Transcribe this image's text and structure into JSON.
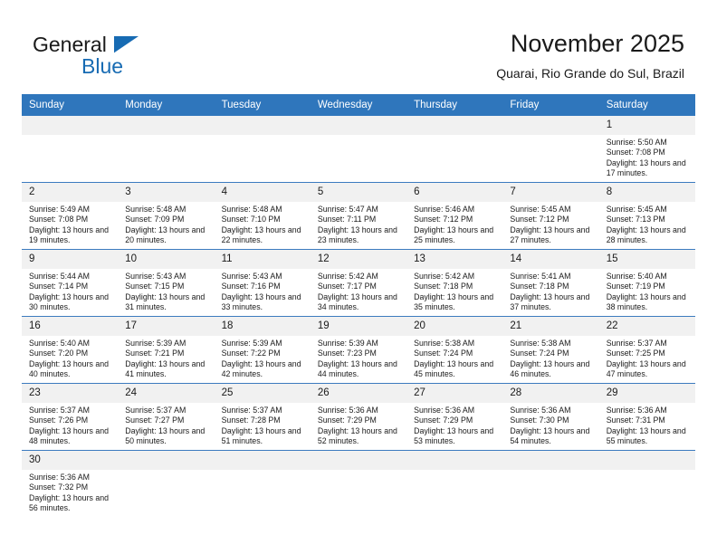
{
  "brand": {
    "name_part1": "General",
    "name_part2": "Blue"
  },
  "header": {
    "title": "November 2025",
    "subtitle": "Quarai, Rio Grande do Sul, Brazil"
  },
  "colors": {
    "header_blue": "#2f76bc",
    "brand_blue": "#176bb3",
    "row_divider": "#3c7bbf",
    "daynum_band": "#f1f1f1"
  },
  "weekdays": [
    "Sunday",
    "Monday",
    "Tuesday",
    "Wednesday",
    "Thursday",
    "Friday",
    "Saturday"
  ],
  "labels": {
    "sunrise_prefix": "Sunrise:",
    "sunset_prefix": "Sunset:",
    "daylight_prefix": "Daylight:"
  },
  "weeks": [
    [
      {
        "day": "",
        "empty": true
      },
      {
        "day": "",
        "empty": true
      },
      {
        "day": "",
        "empty": true
      },
      {
        "day": "",
        "empty": true
      },
      {
        "day": "",
        "empty": true
      },
      {
        "day": "",
        "empty": true
      },
      {
        "day": "1",
        "sunrise": "Sunrise: 5:50 AM",
        "sunset": "Sunset: 7:08 PM",
        "daylight": "Daylight: 13 hours and 17 minutes."
      }
    ],
    [
      {
        "day": "2",
        "sunrise": "Sunrise: 5:49 AM",
        "sunset": "Sunset: 7:08 PM",
        "daylight": "Daylight: 13 hours and 19 minutes."
      },
      {
        "day": "3",
        "sunrise": "Sunrise: 5:48 AM",
        "sunset": "Sunset: 7:09 PM",
        "daylight": "Daylight: 13 hours and 20 minutes."
      },
      {
        "day": "4",
        "sunrise": "Sunrise: 5:48 AM",
        "sunset": "Sunset: 7:10 PM",
        "daylight": "Daylight: 13 hours and 22 minutes."
      },
      {
        "day": "5",
        "sunrise": "Sunrise: 5:47 AM",
        "sunset": "Sunset: 7:11 PM",
        "daylight": "Daylight: 13 hours and 23 minutes."
      },
      {
        "day": "6",
        "sunrise": "Sunrise: 5:46 AM",
        "sunset": "Sunset: 7:12 PM",
        "daylight": "Daylight: 13 hours and 25 minutes."
      },
      {
        "day": "7",
        "sunrise": "Sunrise: 5:45 AM",
        "sunset": "Sunset: 7:12 PM",
        "daylight": "Daylight: 13 hours and 27 minutes."
      },
      {
        "day": "8",
        "sunrise": "Sunrise: 5:45 AM",
        "sunset": "Sunset: 7:13 PM",
        "daylight": "Daylight: 13 hours and 28 minutes."
      }
    ],
    [
      {
        "day": "9",
        "sunrise": "Sunrise: 5:44 AM",
        "sunset": "Sunset: 7:14 PM",
        "daylight": "Daylight: 13 hours and 30 minutes."
      },
      {
        "day": "10",
        "sunrise": "Sunrise: 5:43 AM",
        "sunset": "Sunset: 7:15 PM",
        "daylight": "Daylight: 13 hours and 31 minutes."
      },
      {
        "day": "11",
        "sunrise": "Sunrise: 5:43 AM",
        "sunset": "Sunset: 7:16 PM",
        "daylight": "Daylight: 13 hours and 33 minutes."
      },
      {
        "day": "12",
        "sunrise": "Sunrise: 5:42 AM",
        "sunset": "Sunset: 7:17 PM",
        "daylight": "Daylight: 13 hours and 34 minutes."
      },
      {
        "day": "13",
        "sunrise": "Sunrise: 5:42 AM",
        "sunset": "Sunset: 7:18 PM",
        "daylight": "Daylight: 13 hours and 35 minutes."
      },
      {
        "day": "14",
        "sunrise": "Sunrise: 5:41 AM",
        "sunset": "Sunset: 7:18 PM",
        "daylight": "Daylight: 13 hours and 37 minutes."
      },
      {
        "day": "15",
        "sunrise": "Sunrise: 5:40 AM",
        "sunset": "Sunset: 7:19 PM",
        "daylight": "Daylight: 13 hours and 38 minutes."
      }
    ],
    [
      {
        "day": "16",
        "sunrise": "Sunrise: 5:40 AM",
        "sunset": "Sunset: 7:20 PM",
        "daylight": "Daylight: 13 hours and 40 minutes."
      },
      {
        "day": "17",
        "sunrise": "Sunrise: 5:39 AM",
        "sunset": "Sunset: 7:21 PM",
        "daylight": "Daylight: 13 hours and 41 minutes."
      },
      {
        "day": "18",
        "sunrise": "Sunrise: 5:39 AM",
        "sunset": "Sunset: 7:22 PM",
        "daylight": "Daylight: 13 hours and 42 minutes."
      },
      {
        "day": "19",
        "sunrise": "Sunrise: 5:39 AM",
        "sunset": "Sunset: 7:23 PM",
        "daylight": "Daylight: 13 hours and 44 minutes."
      },
      {
        "day": "20",
        "sunrise": "Sunrise: 5:38 AM",
        "sunset": "Sunset: 7:24 PM",
        "daylight": "Daylight: 13 hours and 45 minutes."
      },
      {
        "day": "21",
        "sunrise": "Sunrise: 5:38 AM",
        "sunset": "Sunset: 7:24 PM",
        "daylight": "Daylight: 13 hours and 46 minutes."
      },
      {
        "day": "22",
        "sunrise": "Sunrise: 5:37 AM",
        "sunset": "Sunset: 7:25 PM",
        "daylight": "Daylight: 13 hours and 47 minutes."
      }
    ],
    [
      {
        "day": "23",
        "sunrise": "Sunrise: 5:37 AM",
        "sunset": "Sunset: 7:26 PM",
        "daylight": "Daylight: 13 hours and 48 minutes."
      },
      {
        "day": "24",
        "sunrise": "Sunrise: 5:37 AM",
        "sunset": "Sunset: 7:27 PM",
        "daylight": "Daylight: 13 hours and 50 minutes."
      },
      {
        "day": "25",
        "sunrise": "Sunrise: 5:37 AM",
        "sunset": "Sunset: 7:28 PM",
        "daylight": "Daylight: 13 hours and 51 minutes."
      },
      {
        "day": "26",
        "sunrise": "Sunrise: 5:36 AM",
        "sunset": "Sunset: 7:29 PM",
        "daylight": "Daylight: 13 hours and 52 minutes."
      },
      {
        "day": "27",
        "sunrise": "Sunrise: 5:36 AM",
        "sunset": "Sunset: 7:29 PM",
        "daylight": "Daylight: 13 hours and 53 minutes."
      },
      {
        "day": "28",
        "sunrise": "Sunrise: 5:36 AM",
        "sunset": "Sunset: 7:30 PM",
        "daylight": "Daylight: 13 hours and 54 minutes."
      },
      {
        "day": "29",
        "sunrise": "Sunrise: 5:36 AM",
        "sunset": "Sunset: 7:31 PM",
        "daylight": "Daylight: 13 hours and 55 minutes."
      }
    ],
    [
      {
        "day": "30",
        "sunrise": "Sunrise: 5:36 AM",
        "sunset": "Sunset: 7:32 PM",
        "daylight": "Daylight: 13 hours and 56 minutes."
      },
      {
        "day": "",
        "empty": true
      },
      {
        "day": "",
        "empty": true
      },
      {
        "day": "",
        "empty": true
      },
      {
        "day": "",
        "empty": true
      },
      {
        "day": "",
        "empty": true
      },
      {
        "day": "",
        "empty": true
      }
    ]
  ]
}
